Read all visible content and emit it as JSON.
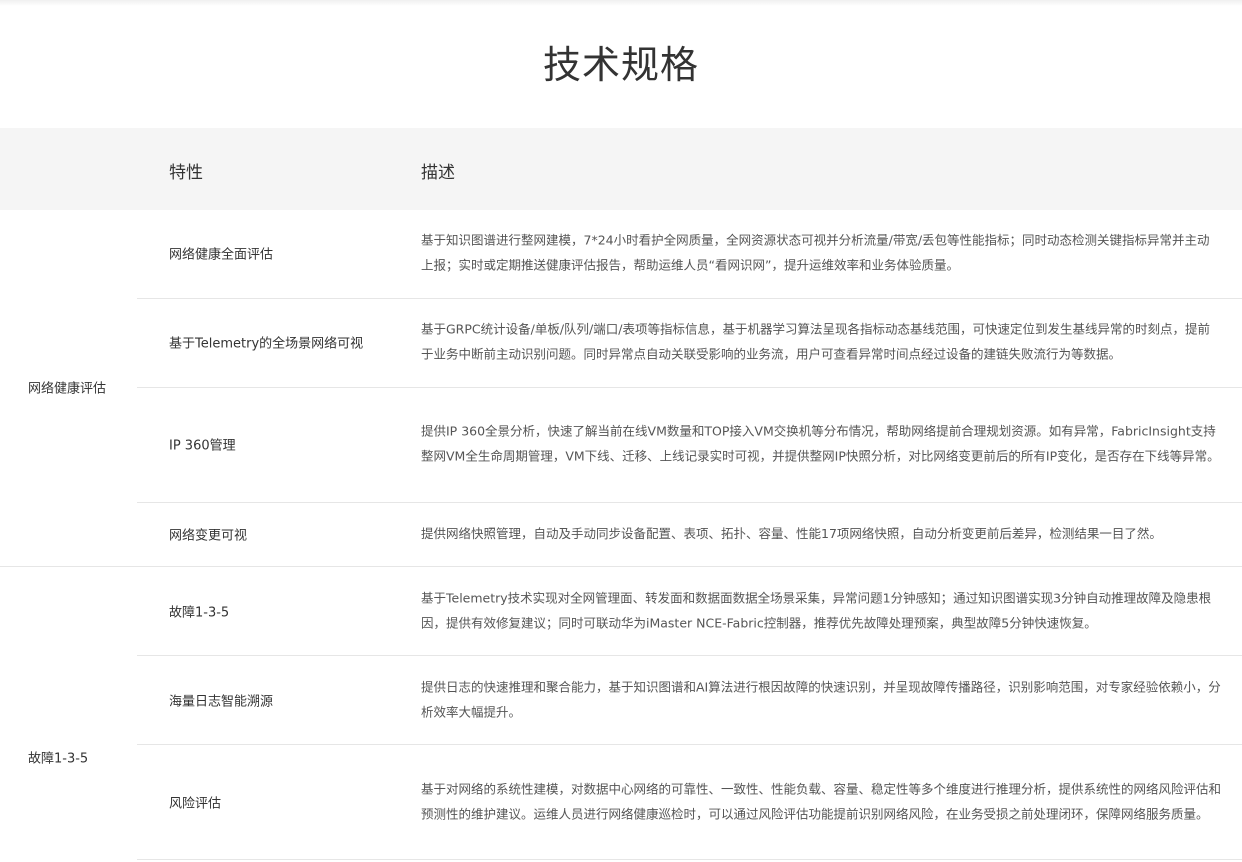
{
  "page": {
    "title": "技术规格"
  },
  "table": {
    "headers": {
      "feature": "特性",
      "description": "描述"
    },
    "groups": [
      {
        "label": "网络健康评估",
        "rows": [
          {
            "feature": "网络健康全面评估",
            "description": "基于知识图谱进行整网建模，7*24小时看护全网质量，全网资源状态可视并分析流量/带宽/丢包等性能指标；同时动态检测关键指标异常并主动上报；实时或定期推送健康评估报告，帮助运维人员“看网识网”，提升运维效率和业务体验质量。"
          },
          {
            "feature": "基于Telemetry的全场景网络可视",
            "description": "基于GRPC统计设备/单板/队列/端口/表项等指标信息，基于机器学习算法呈现各指标动态基线范围，可快速定位到发生基线异常的时刻点，提前于业务中断前主动识别问题。同时异常点自动关联受影响的业务流，用户可查看异常时间点经过设备的建链失败流行为等数据。"
          },
          {
            "feature": "IP 360管理",
            "description": "提供IP 360全景分析，快速了解当前在线VM数量和TOP接入VM交换机等分布情况，帮助网络提前合理规划资源。如有异常，FabricInsight支持整网VM全生命周期管理，VM下线、迁移、上线记录实时可视，并提供整网IP快照分析，对比网络变更前后的所有IP变化，是否存在下线等异常。"
          },
          {
            "feature": "网络变更可视",
            "description": "提供网络快照管理，自动及手动同步设备配置、表项、拓扑、容量、性能17项网络快照，自动分析变更前后差异，检测结果一目了然。"
          }
        ]
      },
      {
        "label": "故障1-3-5",
        "rows": [
          {
            "feature": "故障1-3-5",
            "description": "基于Telemetry技术实现对全网管理面、转发面和数据面数据全场景采集，异常问题1分钟感知；通过知识图谱实现3分钟自动推理故障及隐患根因，提供有效修复建议；同时可联动华为iMaster NCE-Fabric控制器，推荐优先故障处理预案，典型故障5分钟快速恢复。"
          },
          {
            "feature": "海量日志智能溯源",
            "description": "提供日志的快速推理和聚合能力，基于知识图谱和AI算法进行根因故障的快速识别，并呈现故障传播路径，识别影响范围，对专家经验依赖小，分析效率大幅提升。"
          },
          {
            "feature": "风险评估",
            "description": "基于对网络的系统性建模，对数据中心网络的可靠性、一致性、性能负载、容量、稳定性等多个维度进行推理分析，提供系统性的网络风险评估和预测性的维护建议。运维人员进行网络健康巡检时，可以通过风险评估功能提前识别网络风险，在业务受损之前处理闭环，保障网络服务质量。"
          }
        ]
      }
    ]
  }
}
